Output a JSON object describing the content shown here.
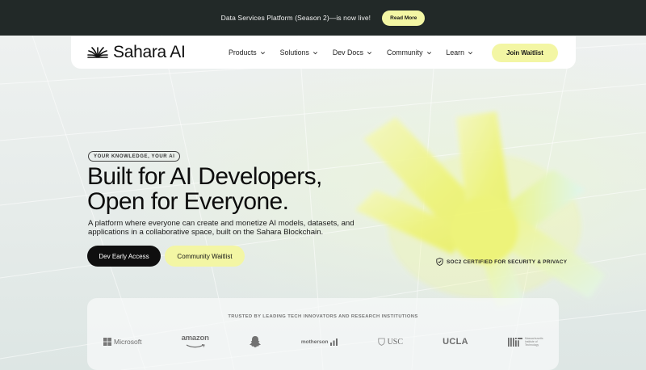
{
  "announcement": {
    "text": "Data Services Platform (Season 2)—is now live!",
    "button": "Read More"
  },
  "nav": {
    "logo": "Sahara AI",
    "links": [
      "Products",
      "Solutions",
      "Dev Docs",
      "Community",
      "Learn"
    ],
    "cta": "Join Waitlist"
  },
  "hero": {
    "badge": "YOUR KNOWLEDGE, YOUR AI",
    "headline_line1": "Built for AI Developers,",
    "headline_line2": "Open for Everyone.",
    "subtext": "A platform where everyone can create and monetize AI models, datasets, and applications in a collaborative space, built on the Sahara Blockchain.",
    "primary_button": "Dev Early Access",
    "secondary_button": "Community Waitlist",
    "certification": "SOC2 CERTIFIED FOR SECURITY & PRIVACY"
  },
  "trusted": {
    "title": "TRUSTED BY LEADING TECH INNOVATORS AND RESEARCH INSTITUTIONS",
    "logos": {
      "microsoft": "Microsoft",
      "amazon": "amazon",
      "snapchat": "",
      "motherson": "motherson",
      "usc": "USC",
      "ucla": "UCLA",
      "mit": "MIT",
      "mit_subtext": "Massachusetts Institute of Technology"
    }
  },
  "colors": {
    "announcement_bg": "#222928",
    "accent_yellow": "#f3f6a4",
    "primary_button_bg": "#0f0f0f",
    "page_bg": "#e9eeed"
  }
}
